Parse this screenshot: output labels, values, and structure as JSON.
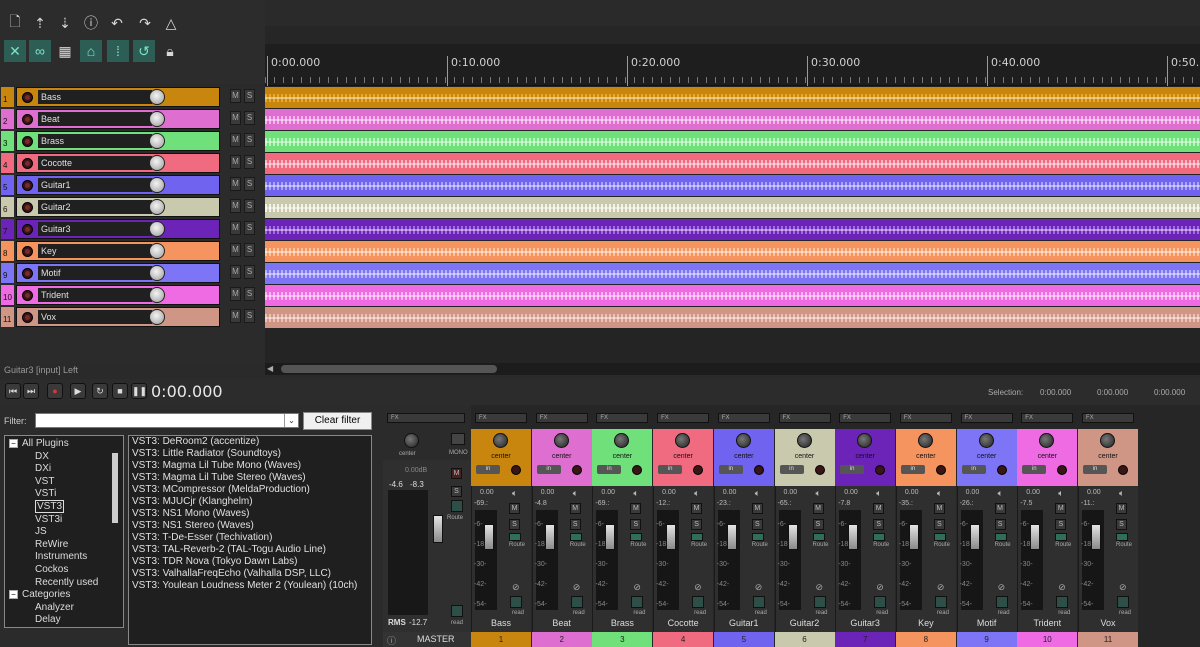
{
  "toolbar": {
    "icons": [
      "new-project-icon",
      "save-icon",
      "download-icon",
      "info-icon",
      "undo-icon",
      "redo-icon",
      "metronome-icon",
      "ripple-edit-icon",
      "link-icon",
      "grid-icon",
      "snap-icon",
      "dots-icon",
      "loop-icon",
      "lock-icon"
    ]
  },
  "ruler": {
    "marks": [
      "0:00.000",
      "0:10.000",
      "0:20.000",
      "0:30.000",
      "0:40.000",
      "0:50.00"
    ]
  },
  "tracks": [
    {
      "num": "1",
      "name": "Bass",
      "color": "#c8860e",
      "wave": "#e8a82a"
    },
    {
      "num": "2",
      "name": "Beat",
      "color": "#de6fd0",
      "wave": "#f6b2ee"
    },
    {
      "num": "3",
      "name": "Brass",
      "color": "#6fe07a",
      "wave": "#b5f8bb"
    },
    {
      "num": "4",
      "name": "Cocotte",
      "color": "#f06b80",
      "wave": "#ffb5c2"
    },
    {
      "num": "5",
      "name": "Guitar1",
      "color": "#6f63f0",
      "wave": "#aba4ff"
    },
    {
      "num": "6",
      "name": "Guitar2",
      "color": "#c9c9ad",
      "wave": "#f2f2e6"
    },
    {
      "num": "7",
      "name": "Guitar3",
      "color": "#6b23b8",
      "wave": "#a26be0"
    },
    {
      "num": "8",
      "name": "Key",
      "color": "#f6945f",
      "wave": "#ffc49f"
    },
    {
      "num": "9",
      "name": "Motif",
      "color": "#7d75f5",
      "wave": "#b5b0ff"
    },
    {
      "num": "10",
      "name": "Trident",
      "color": "#ee6be4",
      "wave": "#ffb2f8"
    },
    {
      "num": "11",
      "name": "Vox",
      "color": "#cf9585",
      "wave": "#ecc2b7"
    }
  ],
  "status": {
    "text": "Guitar3 [input] Left"
  },
  "transport": {
    "time": "0:00.000",
    "selection_label": "Selection:",
    "sel_start": "0:00.000",
    "sel_end": "0:00.000",
    "sel_len": "0:00.000"
  },
  "browser": {
    "filter_label": "Filter:",
    "clear_filter": "Clear filter",
    "tree": [
      {
        "label": "All Plugins",
        "level": 0,
        "expander": "−"
      },
      {
        "label": "DX",
        "level": 1
      },
      {
        "label": "DXi",
        "level": 1
      },
      {
        "label": "VST",
        "level": 1
      },
      {
        "label": "VSTi",
        "level": 1
      },
      {
        "label": "VST3",
        "level": 1,
        "selected": true
      },
      {
        "label": "VST3i",
        "level": 1
      },
      {
        "label": "JS",
        "level": 1
      },
      {
        "label": "ReWire",
        "level": 1
      },
      {
        "label": "Instruments",
        "level": 1
      },
      {
        "label": "Cockos",
        "level": 1
      },
      {
        "label": "Recently used",
        "level": 1
      },
      {
        "label": "Categories",
        "level": 0,
        "expander": "−"
      },
      {
        "label": "Analyzer",
        "level": 2
      },
      {
        "label": "Delay",
        "level": 2
      }
    ],
    "plugins": [
      "VST3: DeRoom2 (accentize)",
      "VST3: Little Radiator (Soundtoys)",
      "VST3: Magma Lil Tube Mono (Waves)",
      "VST3: Magma Lil Tube Stereo (Waves)",
      "VST3: MCompressor (MeldaProduction)",
      "VST3: MJUCjr (Klanghelm)",
      "VST3: NS1 Mono (Waves)",
      "VST3: NS1 Stereo (Waves)",
      "VST3: T-De-Esser (Techivation)",
      "VST3: TAL-Reverb-2 (TAL-Togu Audio Line)",
      "VST3: TDR Nova (Tokyo Dawn Labs)",
      "VST3: ValhallaFreqEcho (Valhalla DSP, LLC)",
      "VST3: Youlean Loudness Meter 2 (Youlean) (10ch)"
    ]
  },
  "master": {
    "fx": "FX",
    "pan": "center",
    "mono": "MONO",
    "volume": "0.00dB",
    "peak_l": "-4.6",
    "peak_r": "-8.3",
    "rms_label": "RMS",
    "rms_value": "-12.7",
    "route": "Route",
    "mode": "read",
    "name": "MASTER",
    "m": "M",
    "s": "S"
  },
  "mixer": {
    "fx": "FX",
    "in": "in",
    "m": "M",
    "s": "S",
    "route": "Route",
    "mode": "read",
    "scale": [
      "-6-",
      "-18-",
      "-30-",
      "-42-",
      "-54-"
    ],
    "strips": [
      {
        "name": "Bass",
        "num": "1",
        "pan": "center",
        "vol": "0.00",
        "peak": "-69.:"
      },
      {
        "name": "Beat",
        "num": "2",
        "pan": "center",
        "vol": "0.00",
        "peak": "-4.8"
      },
      {
        "name": "Brass",
        "num": "3",
        "pan": "center",
        "vol": "0.00",
        "peak": "-69.:"
      },
      {
        "name": "Cocotte",
        "num": "4",
        "pan": "center",
        "vol": "0.00",
        "peak": "-12.:"
      },
      {
        "name": "Guitar1",
        "num": "5",
        "pan": "center",
        "vol": "0.00",
        "peak": "-23.:"
      },
      {
        "name": "Guitar2",
        "num": "6",
        "pan": "center",
        "vol": "0.00",
        "peak": "-65.:"
      },
      {
        "name": "Guitar3",
        "num": "7",
        "pan": "center",
        "vol": "0.00",
        "peak": "-7.8"
      },
      {
        "name": "Key",
        "num": "8",
        "pan": "center",
        "vol": "0.00",
        "peak": "-35.:"
      },
      {
        "name": "Motif",
        "num": "9",
        "pan": "center",
        "vol": "0.00",
        "peak": "-26.:"
      },
      {
        "name": "Trident",
        "num": "10",
        "pan": "center",
        "vol": "0.00",
        "peak": "-7.5"
      },
      {
        "name": "Vox",
        "num": "11",
        "pan": "center",
        "vol": "0.00",
        "peak": "-11.:"
      }
    ]
  }
}
